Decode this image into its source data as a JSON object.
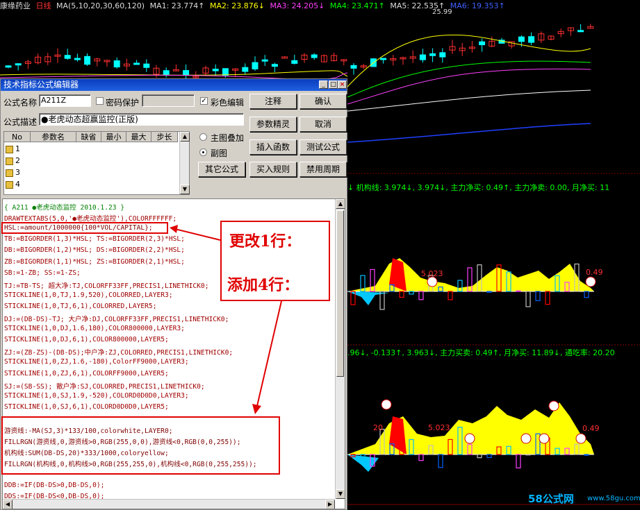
{
  "topbar": {
    "stock_name": "康缘药业",
    "period": "日线",
    "ma_spec": "MA(5,10,20,30,60,120)",
    "ma1": "MA1: 23.774↑",
    "ma2": "MA2: 23.876↓",
    "ma3": "MA3: 24.205↓",
    "ma4": "MA4: 23.471↑",
    "ma5": "MA5: 22.535↑",
    "ma6": "MA6: 19.353↑",
    "high_label": "25.99"
  },
  "middle_panel": {
    "info": "↓ 机构线: 3.974↓, 3.974↓, 主力净买: 0.49↑, 主力净卖: 0.00, 月净买: 11",
    "label_left": "5.023",
    "label_right": "0.49"
  },
  "lower_panel": {
    "info": ".96↓, -0.133↑, 3.963↓, 主力买卖: 0.49↑, 月净买: 11.89↓, 通吃率: 20.20",
    "label_left": "5.023",
    "label_left2": "20",
    "label_right": "0.49"
  },
  "watermark": {
    "brand": "58公式网",
    "url": "www.58gu.com"
  },
  "dialog": {
    "title": "技术指标公式编辑器",
    "name_label": "公式名称",
    "name_value": "A211Z",
    "password_label": "密码保护",
    "color_edit_label": "彩色编辑",
    "color_edit_checked": "✓",
    "desc_label": "公式描述",
    "desc_value": "●老虎动态超赢监控(正版)",
    "param_headers": [
      "No",
      "参数名",
      "缺省",
      "最小",
      "最大",
      "步长"
    ],
    "param_rows": [
      "1",
      "2",
      "3",
      "4"
    ],
    "radio_main": "主图叠加",
    "radio_sub": "副图",
    "buttons": {
      "comment": "注释",
      "confirm": "确认",
      "param_tune": "参数精灵",
      "cancel": "取消",
      "insert_func": "插入函数",
      "test_formula": "测试公式",
      "other_formula": "其它公式",
      "buy_rule": "买入规则",
      "ban_period": "禁用周期"
    },
    "code": [
      "{ A211 ●老虎动态监控   2010.1.23 }",
      "DRAWTEXTABS(5,0,'●老虎动态监控'),COLORFFFFFF;",
      "HSL:=amount/1000000{100*VOL/CAPITAL};",
      "TB:=BIGORDER(1,3)*HSL; TS:=BIGORDER(2,3)*HSL;",
      "DB:=BIGORDER(1,2)*HSL; DS:=BIGORDER(2,2)*HSL;",
      "ZB:=BIGORDER(1,1)*HSL; ZS:=BIGORDER(2,1)*HSL;",
      "SB:=1-ZB;              SS:=1-ZS;",
      "TJ:=TB-TS; 超大净:TJ,COLORFF33FF,PRECIS1,LINETHICK0;",
      "STICKLINE(1,0,TJ,1.9,520),COLORRED,LAYER3;",
      "STICKLINE(1,0,TJ,6,1),COLORRED,LAYER5;",
      "DJ:=(DB-DS)-TJ; 大户净:DJ,COLORFF33FF,PRECIS1,LINETHICK0;",
      "STICKLINE(1,0,DJ,1.6,180),COLOR800000,LAYER3;",
      "STICKLINE(1,0,DJ,6,1),COLOR800000,LAYER5;",
      "ZJ:=(ZB-ZS)-(DB-DS);中户净:ZJ,COLORRED,PRECIS1,LINETHICK0;",
      "STICKLINE(1,0,ZJ,1.6,-180),ColorFF9000,LAYER3;",
      "STICKLINE(1,0,ZJ,6,1),COLORFF9000,LAYER5;",
      "SJ:=(SB-SS);  散户净:SJ,COLORRED,PRECIS1,LINETHICK0;",
      "STICKLINE(1,0,SJ,1.9,-520),COLORD0D0D0,LAYER3;",
      "STICKLINE(1,0,SJ,6,1),COLORD0D0D0,LAYER5;",
      "",
      "游资线:-MA(SJ,3)*133/100,colorwhite,LAYER0;",
      "FILLRGN(游资线,0,游资线>0,RGB(255,0,0),游资线<0,RGB(0,0,255));",
      "机构线:SUM(DB-DS,20)*333/1000,coloryellow;",
      "FILLRGN(机构线,0,机构线>0,RGB(255,255,0),机构线<0,RGB(0,255,255));",
      "",
      "DDB:=IF(DB-DS>0,DB-DS,0);",
      "DDS:=IF(DB-DS<0,DB-DS,0);"
    ]
  },
  "callout": {
    "line1": "更改1行：",
    "line2": "添加4行："
  },
  "colors": {
    "up": "#ff3030",
    "down": "#00ffff",
    "accent": "#e00000"
  }
}
